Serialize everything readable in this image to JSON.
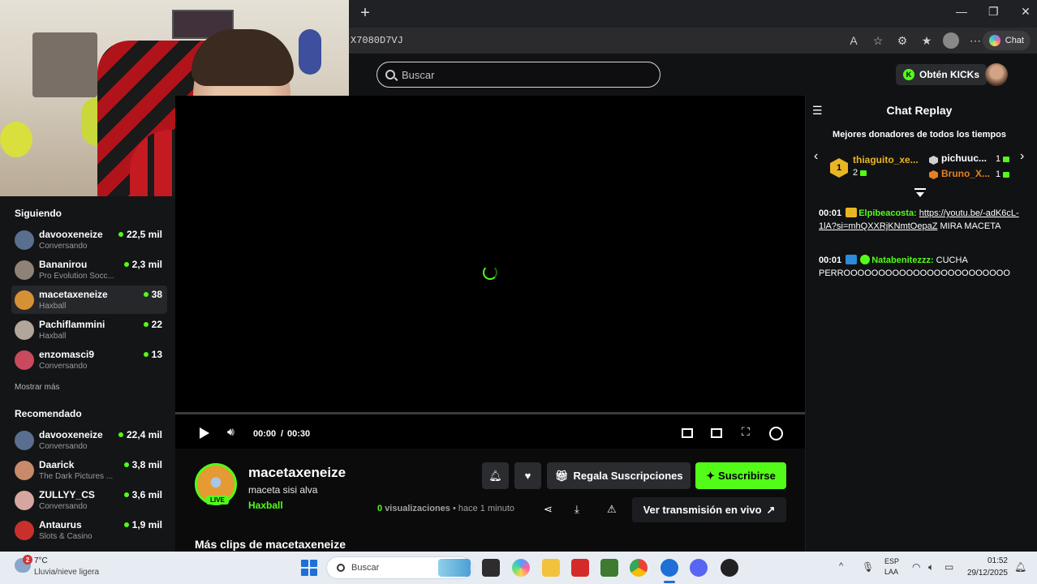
{
  "browser": {
    "url_fragment": "X7080D7VJ",
    "chat_button_label": "Chat"
  },
  "header": {
    "search_placeholder": "Buscar",
    "kicks_button_label": "Obtén KICKs"
  },
  "sidebar": {
    "following_title": "Siguiendo",
    "following": [
      {
        "name": "davooxeneize",
        "sub": "Conversando",
        "count": "22,5 mil"
      },
      {
        "name": "Bananirou",
        "sub": "Pro Evolution Socc...",
        "count": "2,3 mil"
      },
      {
        "name": "macetaxeneize",
        "sub": "Haxball",
        "count": "38"
      },
      {
        "name": "Pachiflammini",
        "sub": "Haxball",
        "count": "22"
      },
      {
        "name": "enzomasci9",
        "sub": "Conversando",
        "count": "13"
      }
    ],
    "show_more": "Mostrar más",
    "recommended_title": "Recomendado",
    "recommended": [
      {
        "name": "davooxeneize",
        "sub": "Conversando",
        "count": "22,4 mil"
      },
      {
        "name": "Daarick",
        "sub": "The Dark Pictures ...",
        "count": "3,8 mil"
      },
      {
        "name": "ZULLYY_CS",
        "sub": "Conversando",
        "count": "3,6 mil"
      },
      {
        "name": "Antaurus",
        "sub": "Slots & Casino",
        "count": "1,9 mil"
      }
    ]
  },
  "player": {
    "time_current": "00:00",
    "time_separator": "/",
    "time_total": "00:30"
  },
  "stream": {
    "live_badge": "LIVE",
    "streamer_name": "macetaxeneize",
    "title": "maceta sisi alva",
    "category": "Haxball",
    "gift_label": "Regala Suscripciones",
    "subscribe_label": "Suscribirse",
    "views_count": "0",
    "views_label": "visualizaciones",
    "views_separator": "•",
    "time_ago": "hace 1 minuto",
    "watch_live_label": "Ver transmisión en vivo",
    "more_clips": "Más clips de macetaxeneize"
  },
  "chat": {
    "title": "Chat Replay",
    "donors_title": "Mejores donadores de todos los tiempos",
    "donors": [
      {
        "rank": "1",
        "name": "thiaguito_xe...",
        "amount": "2",
        "color": "#e8b524"
      },
      {
        "name": "pichuuc...",
        "amount": "1",
        "color": "#ffffff"
      },
      {
        "name": "Bruno_X...",
        "amount": "1",
        "color": "#e7801f"
      }
    ],
    "messages": [
      {
        "time": "00:01",
        "user": "Elpibeacosta:",
        "link": "https://youtu.be/-adK6cL-1lA?si=mhQXXRjKNmtOepaZ",
        "text": "MIRA MACETA"
      },
      {
        "time": "00:01",
        "user": "Natabenitezzz:",
        "text": "CUCHA PERROOOOOOOOOOOOOOOOOOOOOOOO"
      }
    ]
  },
  "taskbar": {
    "weather_badge": "2",
    "weather_temp": "7°C",
    "weather_desc": "Lluvia/nieve ligera",
    "search_label": "Buscar",
    "lang_top": "ESP",
    "lang_bottom": "LAA",
    "clock_time": "01:52",
    "clock_date": "29/12/2025"
  },
  "colors": {
    "kick_green": "#53fc18",
    "gold": "#e8b524",
    "orange": "#e7801f"
  }
}
